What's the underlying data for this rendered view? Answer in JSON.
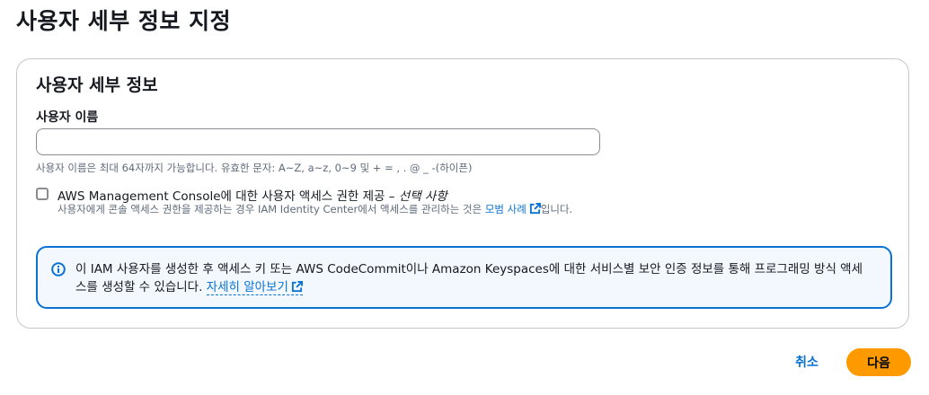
{
  "page": {
    "title": "사용자 세부 정보 지정"
  },
  "panel": {
    "header": "사용자 세부 정보",
    "username": {
      "label": "사용자 이름",
      "value": "",
      "placeholder": "",
      "constraint": "사용자 이름은 최대 64자까지 가능합니다. 유효한 문자: A~Z, a~z, 0~9 및 + = , . @ _ -(하이픈)"
    },
    "console_access": {
      "checked": false,
      "label": "AWS Management Console에 대한 사용자 액세스 권한 제공 – ",
      "optional": "선택 사항",
      "desc_before": "사용자에게 콘솔 액세스 권한을 제공하는 경우 IAM Identity Center에서 액세스를 관리하는 것은 ",
      "desc_link": "모범 사례",
      "desc_after": "입니다."
    },
    "info_alert": {
      "icon": "info-icon",
      "text": "이 IAM 사용자를 생성한 후 액세스 키 또는 AWS CodeCommit이나 Amazon Keyspaces에 대한 서비스별 보안 인증 정보를 통해 프로그래밍 방식 액세스를 생성할 수 있습니다. ",
      "link": "자세히 알아보기"
    }
  },
  "footer": {
    "cancel_label": "취소",
    "next_label": "다음"
  },
  "colors": {
    "accent": "#0972d3",
    "primary_button": "#ff9900",
    "alert_bg": "#f2f8fd"
  }
}
